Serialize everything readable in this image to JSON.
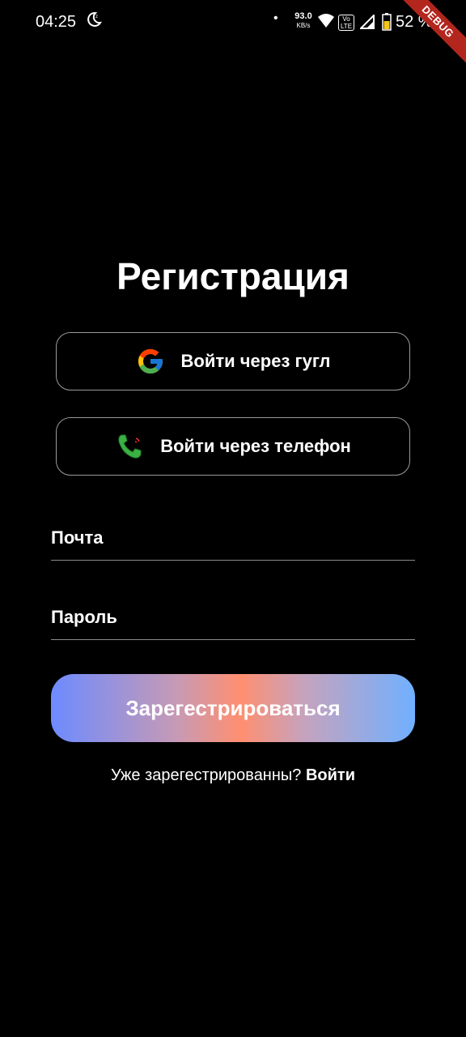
{
  "status_bar": {
    "time": "04:25",
    "speed_value": "93.0",
    "speed_unit": "KB/s",
    "volte": "Vo LTE",
    "battery_percent": "52 %",
    "debug_label": "DEBUG"
  },
  "page": {
    "title": "Регистрация"
  },
  "auth_buttons": {
    "google_label": "Войти через гугл",
    "phone_label": "Войти через телефон"
  },
  "form": {
    "email_placeholder": "Почта",
    "password_placeholder": "Пароль",
    "submit_label": "Зарегестрироваться"
  },
  "footer": {
    "prompt": "Уже зарегестрированны?",
    "login_link": "Войти"
  },
  "colors": {
    "background": "#000000",
    "gradient_left": "#6d8bff",
    "gradient_center": "#ff8f70",
    "gradient_right": "#70b0ff",
    "debug_ribbon": "#b3261e"
  },
  "icons": {
    "google": "google-g-icon",
    "phone": "green-phone-icon",
    "moon": "do-not-disturb-moon-icon",
    "wifi": "wifi-icon",
    "signal": "cell-signal-icon",
    "battery": "battery-charging-icon"
  }
}
